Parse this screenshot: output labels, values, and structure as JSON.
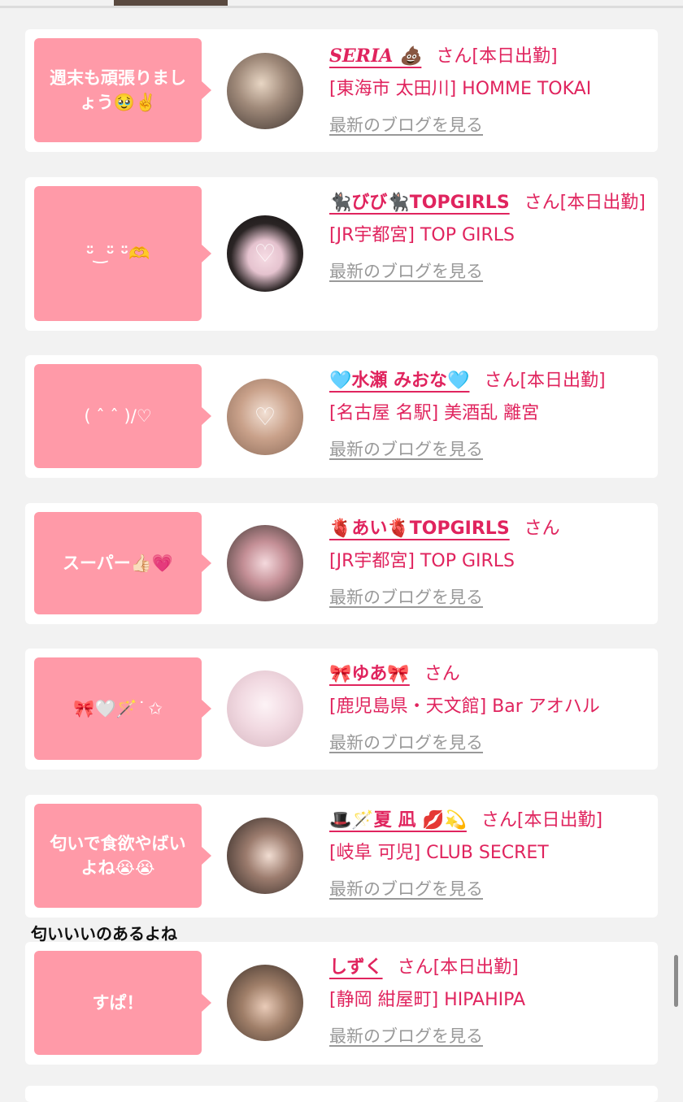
{
  "posts": [
    {
      "bubble": "週末も頑張りましょう🥹✌️",
      "name": "SERIA 💩",
      "san": "さん[本日出勤]",
      "shop": "[東海市 太田川] HOMME TOKAI",
      "blog": "最新のブログを見る",
      "avatar_color": "#6b5a55"
    },
    {
      "bubble": "ᵕ̈ ͜ ᵕ̈ ᵕ̈🫶",
      "name": "🐈‍⬛びび🐈‍⬛TOPGIRLS",
      "san": "さん[本日出勤]",
      "shop": "[JR宇都宮] TOP GIRLS",
      "blog": "最新のブログを見る",
      "avatar_color": "#1d1a1a"
    },
    {
      "bubble": "( ˆ ˆ )/♡",
      "name": "🩵水瀬 みおな🩵",
      "san": "さん[本日出勤]",
      "shop": "[名古屋 名駅] 美酒乱 離宮",
      "blog": "最新のブログを見る",
      "avatar_color": "#d9bba8"
    },
    {
      "bubble": "スーパー👍🏻💗",
      "name": "🫀あい🫀TOPGIRLS",
      "san": "さん",
      "shop": "[JR宇都宮] TOP GIRLS",
      "blog": "最新のブログを見る",
      "avatar_color": "#5a4a45"
    },
    {
      "bubble": "🎀🤍🪄 ͘ ✩",
      "name": "🎀ゆあ🎀",
      "san": "さん",
      "shop": "[鹿児島県・天文館] Bar アオハル",
      "blog": "最新のブログを見る",
      "avatar_color": "#f3e4ea"
    },
    {
      "bubble": "匂いで食欲やばいよね😭😭",
      "name": "🎩🪄夏 凪 💋💫",
      "san": "さん[本日出勤]",
      "shop": "[岐阜 可児] CLUB SECRET",
      "blog": "最新のブログを見る",
      "avatar_color": "#3a2f2c"
    },
    {
      "bubble": "すぱ！",
      "name": "しずく",
      "san": "さん[本日出勤]",
      "shop": "[静岡 紺屋町] HIPAHIPA",
      "blog": "最新のブログを見る",
      "avatar_color": "#5c4a3e"
    }
  ],
  "comment": "匂いいいのあるよね",
  "colors": {
    "accent": "#e0245e",
    "bubble": "#ff9aa8",
    "link_gray": "#999999"
  }
}
